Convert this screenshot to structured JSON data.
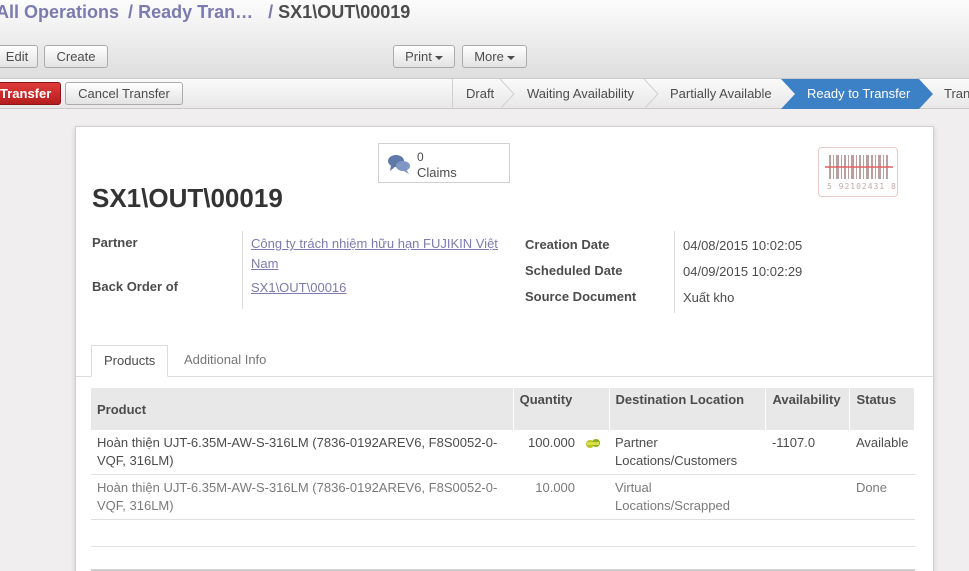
{
  "breadcrumb": {
    "items": [
      "All Operations",
      "Ready Tran…"
    ],
    "separator": "/",
    "current": "SX1\\OUT\\00019"
  },
  "toolbar": {
    "edit_label": "Edit",
    "create_label": "Create",
    "print_label": "Print",
    "more_label": "More"
  },
  "statusbar": {
    "transfer_label": "Transfer",
    "cancel_label": "Cancel Transfer",
    "stages": [
      "Draft",
      "Waiting Availability",
      "Partially Available",
      "Ready to Transfer",
      "Tran"
    ],
    "active_stage": "Ready to Transfer"
  },
  "form": {
    "claims_count": "0",
    "claims_label": "Claims",
    "title": "SX1\\OUT\\00019",
    "barcode_text": "5 92102431 8",
    "partner_label": "Partner",
    "partner_value": "Công ty trách nhiệm hữu hạn FUJIKIN Việt Nam",
    "back_order_label": "Back Order of",
    "back_order_value": "SX1\\OUT\\00016",
    "creation_date_label": "Creation Date",
    "creation_date_value": "04/08/2015 10:02:05",
    "scheduled_date_label": "Scheduled Date",
    "scheduled_date_value": "04/09/2015 10:02:29",
    "source_document_label": "Source Document",
    "source_document_value": "Xuất kho"
  },
  "tabs": [
    "Products",
    "Additional Info"
  ],
  "table": {
    "headers": [
      "Product",
      "Quantity",
      "Destination Location",
      "Availability",
      "Status"
    ],
    "rows": [
      {
        "product": "Hoàn thiện UJT-6.35M-AW-S-316LM (7836-0192AREV6, F8S0052-0-VQF, 316LM)",
        "quantity": "100.000",
        "destination": "Partner Locations/Customers",
        "availability": "-1107.0",
        "status": "Available"
      },
      {
        "product": "Hoàn thiện UJT-6.35M-AW-S-316LM (7836-0192AREV6, F8S0052-0-VQF, 316LM)",
        "quantity": "10.000",
        "destination": "Virtual Locations/Scrapped",
        "availability": "",
        "status": "Done"
      }
    ]
  },
  "colors": {
    "link": "#7c7bad",
    "active_stage": "#3c80c6",
    "primary_button": "#c12828"
  }
}
